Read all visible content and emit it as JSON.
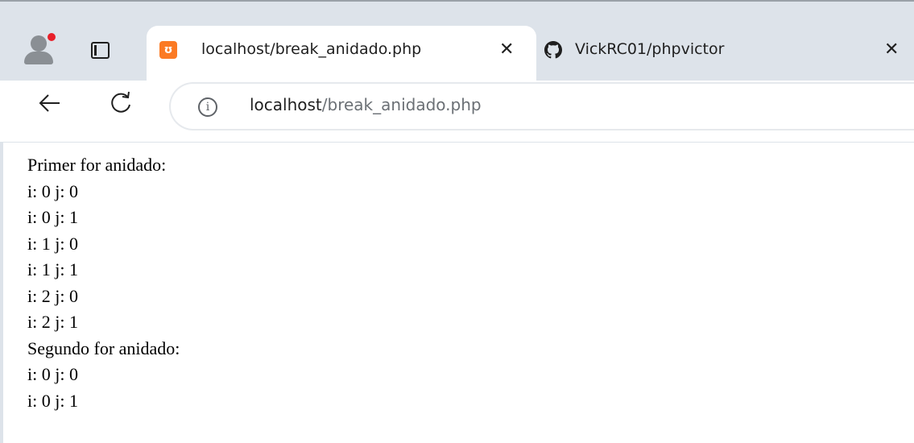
{
  "browser": {
    "tabs": [
      {
        "title": "localhost/break_anidado.php",
        "favicon": "xampp-icon",
        "active": true,
        "close": "✕"
      },
      {
        "title": "VickRC01/phpvictor",
        "favicon": "github-icon",
        "active": false,
        "close": "✕"
      }
    ],
    "address_bar": {
      "host": "localhost",
      "path": "/break_anidado.php",
      "info_glyph": "i"
    },
    "accent_color": "#fb7a24",
    "profile_badge_color": "#e8202a"
  },
  "page": {
    "lines": [
      "Primer for anidado:",
      "i: 0 j: 0",
      "i: 0 j: 1",
      "i: 1 j: 0",
      "i: 1 j: 1",
      "i: 2 j: 0",
      "i: 2 j: 1",
      "Segundo for anidado:",
      "i: 0 j: 0",
      "i: 0 j: 1"
    ]
  }
}
